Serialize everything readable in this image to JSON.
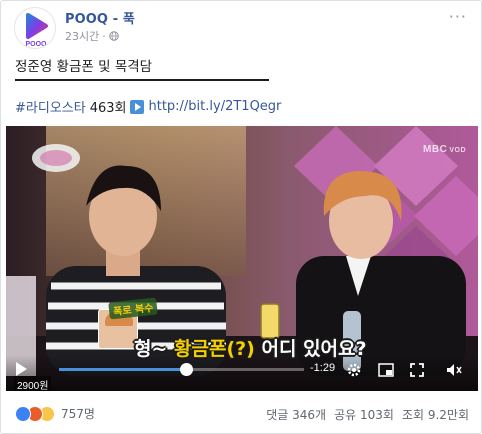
{
  "page": {
    "name": "POOQ - 푹",
    "logo_text": "POOQ",
    "time": "23시간",
    "more_label": "···"
  },
  "post": {
    "title": "정준영 황금폰 및 목격담",
    "hashtag": "#라디오스타",
    "episode": "463회",
    "link": "http://bit.ly/2T1Qegr"
  },
  "video": {
    "watermark": "MBC",
    "watermark_sub": "VOD",
    "caption_tag": "폭로 복수",
    "subtitle_prefix": "형~",
    "subtitle_highlight": "황금폰(?)",
    "subtitle_suffix": "어디 있어요?",
    "time_remaining": "-1:29",
    "price_badge": "2900원",
    "progress_fraction": 0.52
  },
  "reactions": {
    "count": "757명",
    "types": [
      "like",
      "angry",
      "haha"
    ]
  },
  "stats": {
    "comments": "댓글 346개",
    "shares": "공유 103회",
    "views": "조회 9.2만회"
  },
  "colors": {
    "link": "#365899",
    "progress": "#4a90d9",
    "subtitle_yellow": "#f5d000"
  }
}
